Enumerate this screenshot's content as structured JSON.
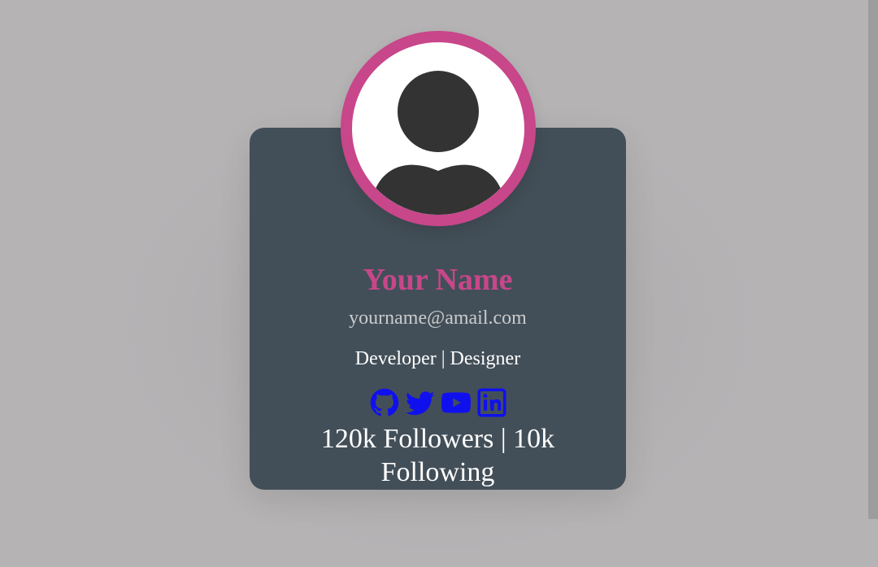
{
  "profile": {
    "name": "Your Name",
    "email": "yourname@amail.com",
    "role": "Developer | Designer",
    "stats": "120k Followers | 10k Following"
  },
  "socials": [
    {
      "icon": "github-icon"
    },
    {
      "icon": "twitter-icon"
    },
    {
      "icon": "youtube-icon"
    },
    {
      "icon": "linkedin-icon"
    }
  ],
  "colors": {
    "background": "#b5b3b4",
    "card": "#434f58",
    "accent": "#c8468a",
    "email_text": "#c9ccce",
    "icon_color": "#1010ee",
    "avatar_silhouette": "#333333"
  }
}
